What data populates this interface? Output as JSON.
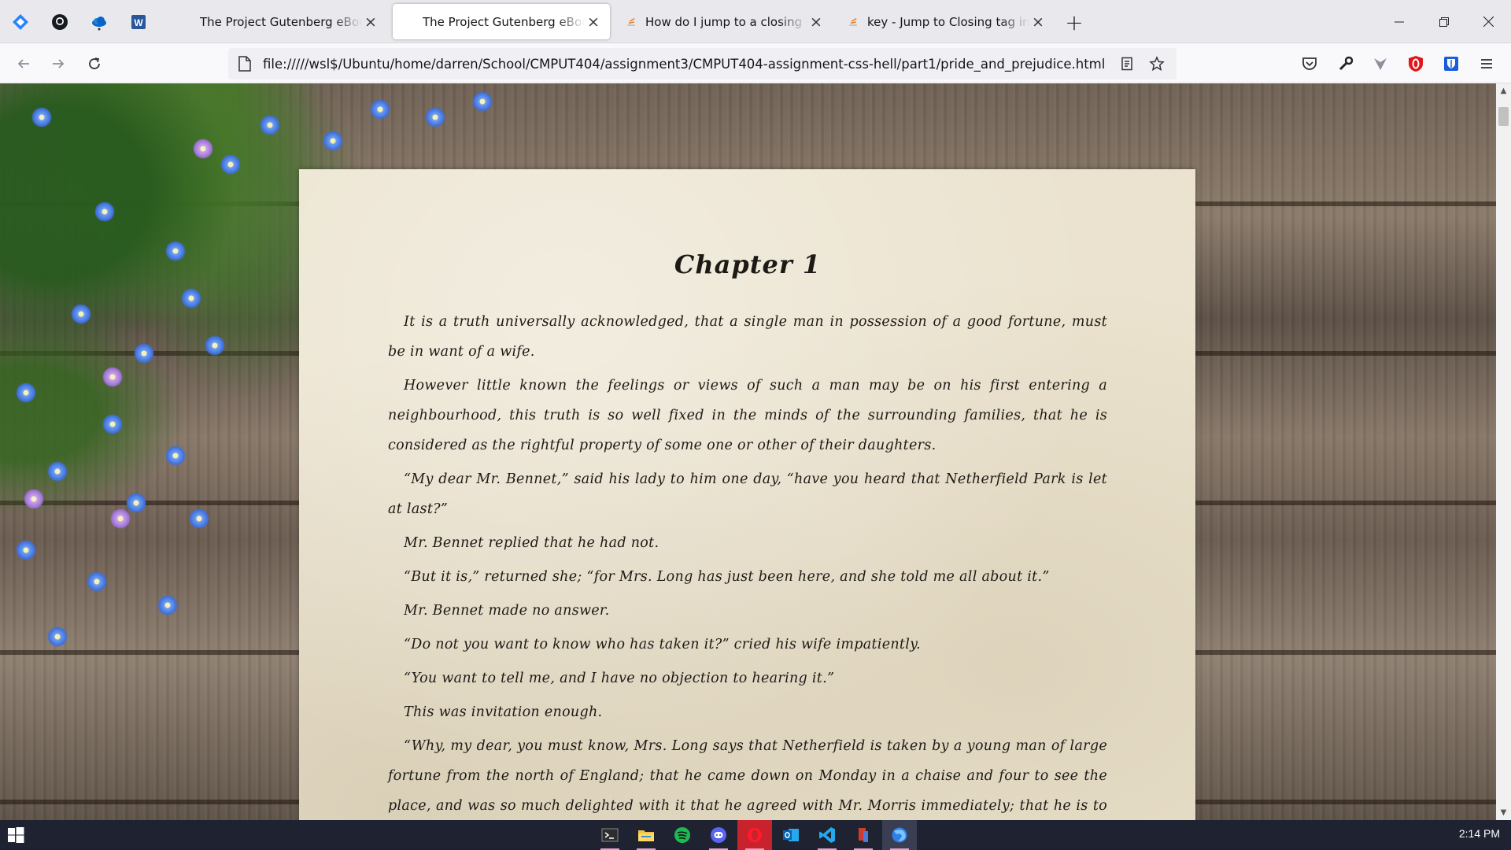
{
  "browser": {
    "tabs": [
      {
        "title": "The Project Gutenberg eBook of Frankenstein",
        "active": false,
        "favicon": "book-icon"
      },
      {
        "title": "The Project Gutenberg eBook of Pride and Prejudice",
        "active": true,
        "favicon": "book-icon"
      },
      {
        "title": "How do I jump to a closing bracket",
        "active": false,
        "favicon": "stackoverflow-icon"
      },
      {
        "title": "key - Jump to Closing tag in VS Code",
        "active": false,
        "favicon": "stackoverflow-icon"
      }
    ],
    "new_tab_label": "+",
    "url": "file://///wsl$/Ubuntu/home/darren/School/CMPUT404/assignment3/CMPUT404-assignment-css-hell/part1/pride_and_prejudice.html"
  },
  "page": {
    "chapter_title": "Chapter 1",
    "paragraphs": [
      "It is a truth universally acknowledged, that a single man in possession of a good fortune, must be in want of a wife.",
      "However little known the feelings or views of such a man may be on his first entering a neighbourhood, this truth is so well fixed in the minds of the surrounding families, that he is considered as the rightful property of some one or other of their daughters.",
      "“My dear Mr. Bennet,” said his lady to him one day, “have you heard that Netherfield Park is let at last?”",
      "Mr. Bennet replied that he had not.",
      "“But it is,” returned she; “for Mrs. Long has just been here, and she told me all about it.”",
      "Mr. Bennet made no answer.",
      "“Do not you want to know who has taken it?” cried his wife impatiently.",
      "“You want to tell me, and I have no objection to hearing it.”",
      "This was invitation enough.",
      "“Why, my dear, you must know, Mrs. Long says that Netherfield is taken by a young man of large fortune from the north of England; that he came down on Monday in a chaise and four to see the place, and was so much delighted with it that he agreed with Mr. Morris immediately; that he is to take possession"
    ]
  },
  "taskbar": {
    "clock": "2:14 PM"
  },
  "colors": {
    "accent_blue": "#0060df",
    "taskbar": "#1f2230",
    "paper": "#ebe3cf"
  }
}
